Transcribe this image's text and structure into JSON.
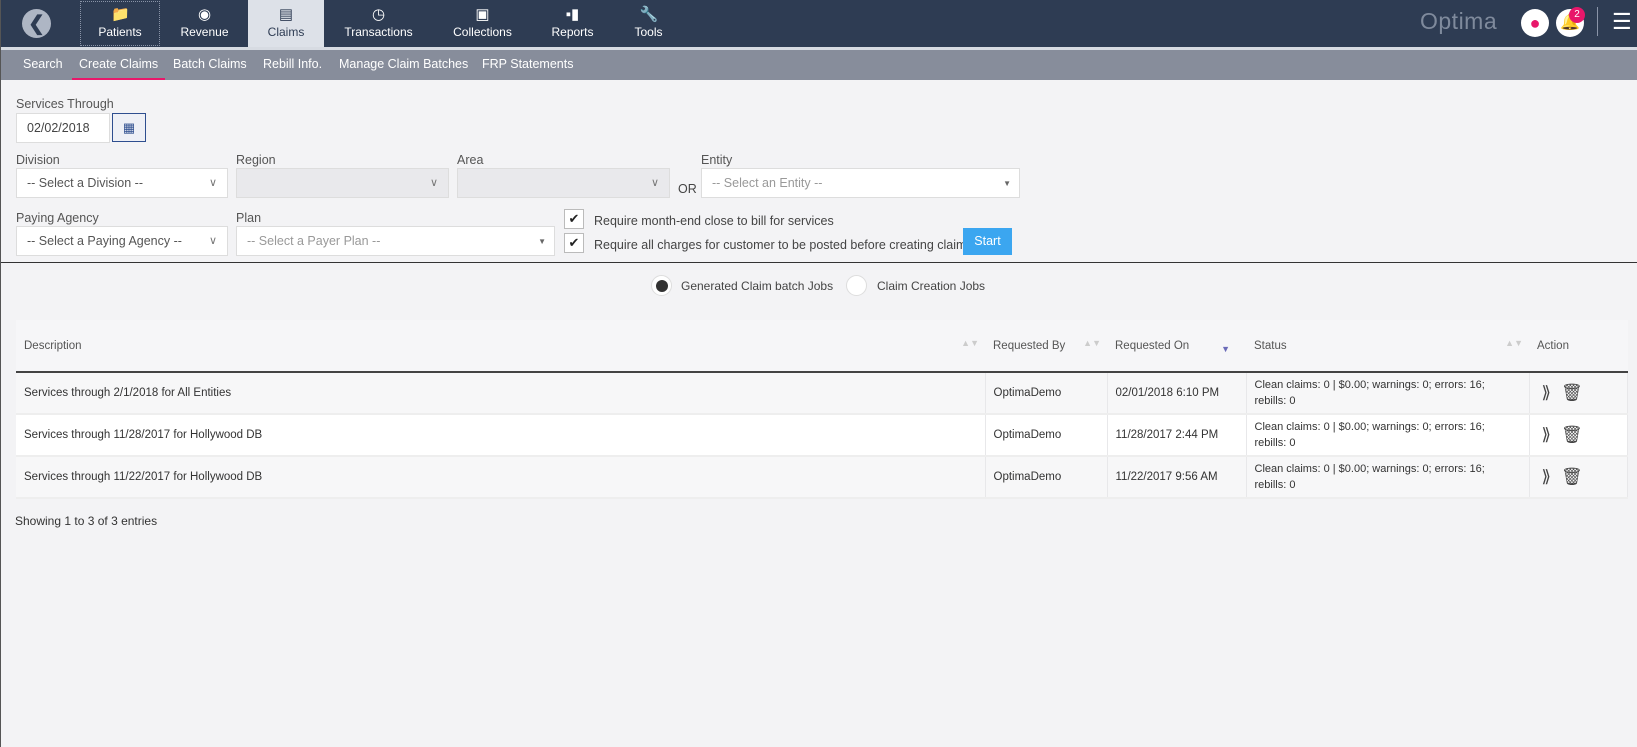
{
  "nav": {
    "brand": "Optima",
    "notifications": "2",
    "items": [
      {
        "label": "Patients",
        "icon": "patients-folder-icon"
      },
      {
        "label": "Revenue",
        "icon": "revenue-icon"
      },
      {
        "label": "Claims",
        "icon": "claims-tray-icon",
        "active": true
      },
      {
        "label": "Transactions",
        "icon": "transactions-clock-icon"
      },
      {
        "label": "Collections",
        "icon": "collections-icon"
      },
      {
        "label": "Reports",
        "icon": "reports-chart-icon"
      },
      {
        "label": "Tools",
        "icon": "wrench-icon"
      }
    ]
  },
  "subnav": {
    "items": [
      "Search",
      "Create Claims",
      "Batch Claims",
      "Rebill Info.",
      "Manage Claim Batches",
      "FRP Statements"
    ],
    "active": "Create Claims"
  },
  "form": {
    "services_through_label": "Services Through",
    "services_through_value": "02/02/2018",
    "division_label": "Division",
    "division_value": "-- Select a Division --",
    "region_label": "Region",
    "area_label": "Area",
    "or_label": "OR",
    "entity_label": "Entity",
    "entity_value": "-- Select an Entity --",
    "paying_agency_label": "Paying Agency",
    "paying_agency_value": "-- Select a Paying Agency --",
    "plan_label": "Plan",
    "plan_value": "-- Select a Payer Plan --",
    "check1": "Require month-end close to bill for services",
    "check1_checked": true,
    "check2": "Require all charges for customer to be posted before creating claim",
    "check2_checked": true,
    "start": "Start"
  },
  "jobs": {
    "radio1": "Generated Claim batch Jobs",
    "radio2": "Claim Creation Jobs",
    "selected": "Generated Claim batch Jobs"
  },
  "table": {
    "headers": [
      "Description",
      "Requested By",
      "Requested On",
      "Status",
      "Action"
    ],
    "sorted_column": "Requested On",
    "rows": [
      {
        "description": "Services through 2/1/2018 for All Entities",
        "by": "OptimaDemo",
        "on": "02/01/2018 6:10 PM",
        "status1": "Clean claims: 0 | $0.00; warnings: 0; errors: 16;",
        "status2": "rebills: 0"
      },
      {
        "description": "Services through 11/28/2017 for Hollywood DB",
        "by": "OptimaDemo",
        "on": "11/28/2017 2:44 PM",
        "status1": "Clean claims: 0 | $0.00; warnings: 0; errors: 16;",
        "status2": "rebills: 0"
      },
      {
        "description": "Services through 11/22/2017 for Hollywood DB",
        "by": "OptimaDemo",
        "on": "11/22/2017 9:56 AM",
        "status1": "Clean claims: 0 | $0.00; warnings: 0; errors: 16;",
        "status2": "rebills: 0"
      }
    ]
  },
  "footer": {
    "showing": "Showing 1 to 3 of 3 entries"
  }
}
